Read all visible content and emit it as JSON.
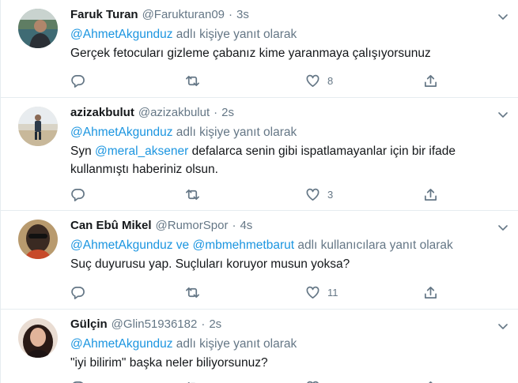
{
  "tweets": [
    {
      "name": "Faruk Turan",
      "handle": "@Farukturan09",
      "time": "3s",
      "reply_to": "@AhmetAkgunduz",
      "reply_suffix": " adlı kişiye yanıt olarak",
      "text": "Gerçek fetocuları gizleme çabanız kime yaranmaya çalışıyorsunuz",
      "likes": "8"
    },
    {
      "name": "azizakbulut",
      "handle": "@azizakbulut",
      "time": "2s",
      "reply_to": "@AhmetAkgunduz",
      "reply_suffix": " adlı kişiye yanıt olarak",
      "text_pre": "Syn ",
      "text_mention": "@meral_aksener",
      "text_post": " defalarca senin gibi  ispatlamayanlar için bir ifade kullanmıştı haberiniz olsun.",
      "likes": "3"
    },
    {
      "name": "Can Ebû Mikel",
      "handle": "@RumorSpor",
      "time": "4s",
      "reply_to": "@AhmetAkgunduz ve @mbmehmetbarut",
      "reply_suffix": " adlı kullanıcılara yanıt olarak",
      "text": "Suç duyurusu yap. Suçluları koruyor musun yoksa?",
      "likes": "11"
    },
    {
      "name": "Gülçin",
      "handle": "@Glin51936182",
      "time": "2s",
      "reply_to": "@AhmetAkgunduz",
      "reply_suffix": " adlı kişiye yanıt olarak",
      "text": "\"iyi bilirim\" başka neler biliyorsunuz?"
    }
  ],
  "colors": {
    "link": "#1b95e0",
    "secondary": "#657786",
    "text": "#14171a",
    "divider": "#e6ecf0"
  },
  "icons": [
    "reply-icon",
    "retweet-icon",
    "like-icon",
    "share-icon",
    "chevron-down-icon"
  ]
}
